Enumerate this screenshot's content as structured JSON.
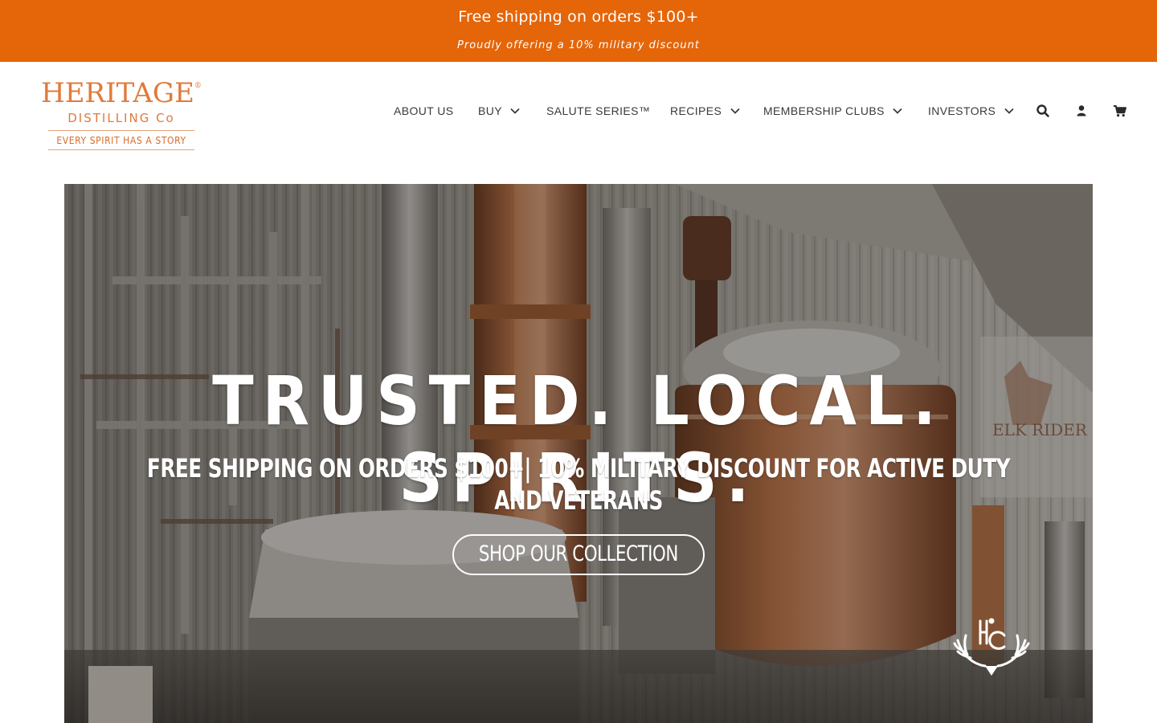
{
  "announcement": {
    "line1": "Free shipping on orders $100+",
    "line2": "Proudly offering a 10% military discount",
    "background_color": "#e56509"
  },
  "logo": {
    "brand": "HERITAGE",
    "subtitle": "DISTILLING Co",
    "tagline": "EVERY SPIRIT HAS A STORY",
    "color": "#e07a3a"
  },
  "nav": {
    "items": [
      {
        "label": "ABOUT US",
        "has_dropdown": false
      },
      {
        "label": "BUY",
        "has_dropdown": true
      },
      {
        "label": "SALUTE SERIES™",
        "has_dropdown": false
      },
      {
        "label": "RECIPES",
        "has_dropdown": true
      },
      {
        "label": "MEMBERSHIP CLUBS",
        "has_dropdown": true
      },
      {
        "label": "INVESTORS",
        "has_dropdown": true
      }
    ],
    "icons": [
      "search-icon",
      "account-icon",
      "cart-icon"
    ]
  },
  "hero": {
    "title": "TRUSTED. LOCAL. SPIRITS.",
    "subtitle": "FREE SHIPPING ON ORDERS $100+| 10% MILITARY DISCOUNT FOR ACTIVE DUTY AND VETERANS",
    "button_label": "SHOP OUR COLLECTION",
    "wall_sign": "ELK RIDER",
    "badge_icon": "hdc-antler-logo-icon"
  }
}
